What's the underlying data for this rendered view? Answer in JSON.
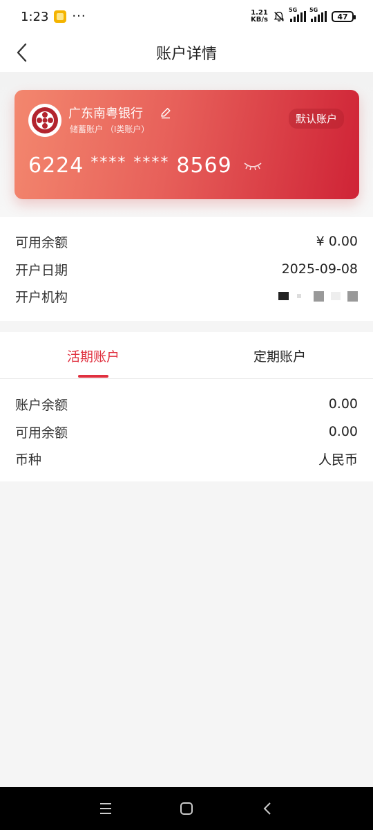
{
  "status_bar": {
    "time": "1:23",
    "net_speed_value": "1.21",
    "net_speed_unit": "KB/s",
    "network_1": "5G",
    "network_2": "5G",
    "battery": "47"
  },
  "header": {
    "title": "账户详情"
  },
  "card": {
    "bank_name": "广东南粤银行",
    "account_type": "储蓄账户 （I类账户）",
    "default_badge": "默认账户",
    "number_prefix": "6224",
    "number_mask_1": "****",
    "number_mask_2": "****",
    "number_suffix": "8569"
  },
  "info": {
    "available_balance_label": "可用余额",
    "available_balance_value": "¥ 0.00",
    "open_date_label": "开户日期",
    "open_date_value": "2025-09-08",
    "open_branch_label": "开户机构"
  },
  "tabs": {
    "current": "活期账户",
    "fixed": "定期账户"
  },
  "details": {
    "account_balance_label": "账户余额",
    "account_balance_value": "0.00",
    "available_balance_label": "可用余额",
    "available_balance_value": "0.00",
    "currency_label": "币种",
    "currency_value": "人民币"
  },
  "colors": {
    "accent": "#e0303f",
    "card_start": "#f3876e",
    "card_end": "#cf2336"
  }
}
